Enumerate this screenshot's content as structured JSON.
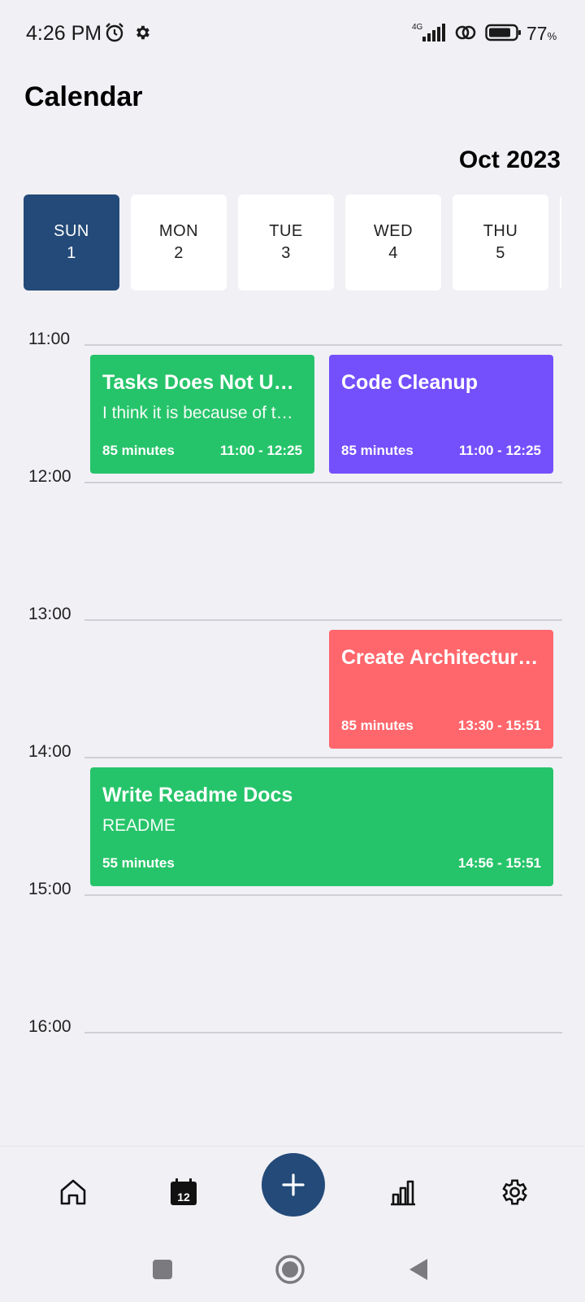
{
  "status_bar": {
    "time": "4:26 PM",
    "network": "4G",
    "battery_percent": "77",
    "battery_unit": "%",
    "icons": [
      "alarm-icon",
      "gear-icon",
      "signal-icon",
      "hotspot-icon",
      "battery-icon"
    ]
  },
  "header": {
    "title": "Calendar",
    "month": "Oct 2023"
  },
  "days": [
    {
      "name": "SUN",
      "date": "1",
      "selected": true
    },
    {
      "name": "MON",
      "date": "2",
      "selected": false
    },
    {
      "name": "TUE",
      "date": "3",
      "selected": false
    },
    {
      "name": "WED",
      "date": "4",
      "selected": false
    },
    {
      "name": "THU",
      "date": "5",
      "selected": false
    }
  ],
  "hours": [
    "11:00",
    "12:00",
    "13:00",
    "14:00",
    "15:00",
    "16:00"
  ],
  "events": [
    {
      "title": "Tasks Does Not Update",
      "description": "I think it is because of the sync",
      "duration": "85 minutes",
      "range": "11:00 - 12:25",
      "color": "#26c46a"
    },
    {
      "title": "Code Cleanup",
      "description": "",
      "duration": "85 minutes",
      "range": "11:00 - 12:25",
      "color": "#744ffc"
    },
    {
      "title": "Create Architecture Diagram",
      "description": "",
      "duration": "85 minutes",
      "range": "13:30 - 15:51",
      "color": "#ff676c"
    },
    {
      "title": "Write Readme Docs",
      "description": "README",
      "duration": "55 minutes",
      "range": "14:56 - 15:51",
      "color": "#26c46a"
    }
  ],
  "bottom_nav": {
    "items": [
      "home-icon",
      "calendar-icon",
      "add-icon",
      "stats-icon",
      "settings-icon"
    ],
    "calendar_icon_number": "12",
    "accent": "#234a78"
  },
  "system_nav": [
    "recents-icon",
    "home-circle-icon",
    "back-icon"
  ]
}
